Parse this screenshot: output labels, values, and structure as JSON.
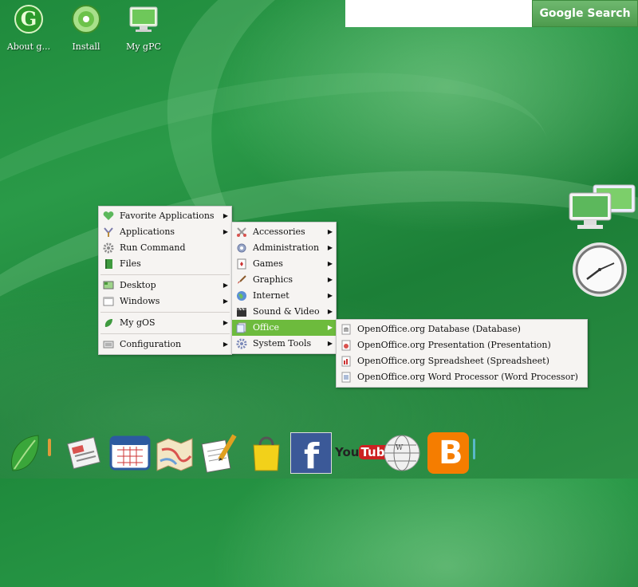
{
  "desktop_icons": [
    {
      "label": "About g..."
    },
    {
      "label": "Install"
    },
    {
      "label": "My gPC"
    }
  ],
  "google": {
    "button_label": "Google Search",
    "input_value": ""
  },
  "main_menu": [
    {
      "label": "Favorite Applications",
      "icon": "heart-icon"
    },
    {
      "label": "Applications",
      "icon": "tools-icon"
    },
    {
      "label": "Run Command",
      "icon": "gear-icon"
    },
    {
      "label": "Files",
      "icon": "book-icon"
    },
    {
      "label": "Desktop",
      "icon": "desktop-icon"
    },
    {
      "label": "Windows",
      "icon": "window-icon"
    },
    {
      "label": "My gOS",
      "icon": "leaf-icon"
    },
    {
      "label": "Configuration",
      "icon": "config-icon"
    }
  ],
  "applications_menu": [
    {
      "label": "Accessories"
    },
    {
      "label": "Administration"
    },
    {
      "label": "Games"
    },
    {
      "label": "Graphics"
    },
    {
      "label": "Internet"
    },
    {
      "label": "Sound & Video"
    },
    {
      "label": "Office"
    },
    {
      "label": "System Tools"
    }
  ],
  "office_menu": [
    {
      "label": "OpenOffice.org Database (Database)"
    },
    {
      "label": "OpenOffice.org Presentation (Presentation)"
    },
    {
      "label": "OpenOffice.org Spreadsheet (Spreadsheet)"
    },
    {
      "label": "OpenOffice.org Word Processor (Word Processor)"
    }
  ],
  "dock": {
    "youtube_text": "YouTube"
  },
  "colors": {
    "menu_highlight": "#6dbb3d",
    "google_button": "#4d9b4d"
  }
}
